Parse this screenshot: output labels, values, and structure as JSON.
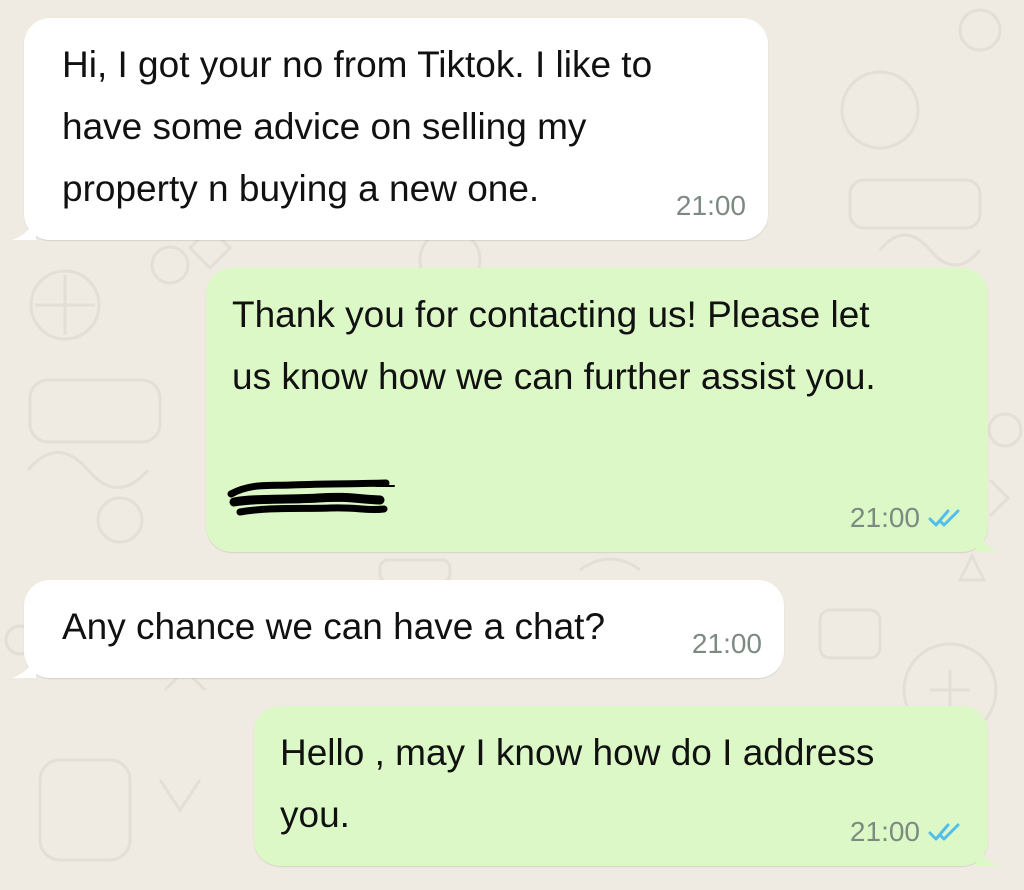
{
  "theme": {
    "chat_background": "#efeae2",
    "incoming_bubble": "#ffffff",
    "outgoing_bubble": "#dcf8c6",
    "timestamp_color": "#7d8a82",
    "read_receipt_color": "#53bdeb",
    "redaction_color": "#000000"
  },
  "messages": [
    {
      "direction": "incoming",
      "text": "Hi, I got your no from Tiktok. I like to\nhave some advice on selling my\nproperty n buying a new one.",
      "time": "21:00"
    },
    {
      "direction": "outgoing",
      "text": "Thank you for contacting us! Please let\nus know how we can further assist you.",
      "time": "21:00",
      "status_icon": "double-check-icon",
      "redacted_signature": true
    },
    {
      "direction": "incoming",
      "text": "Any chance we can have a chat?",
      "time": "21:00"
    },
    {
      "direction": "outgoing",
      "text": "Hello , may I know how do I address\nyou.",
      "time": "21:00",
      "status_icon": "double-check-icon"
    }
  ]
}
